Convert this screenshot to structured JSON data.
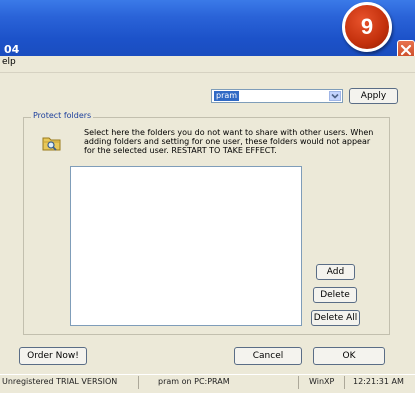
{
  "window": {
    "title": "04",
    "menu_text": "elp"
  },
  "step_badge": "9",
  "user_select": {
    "value": "pram"
  },
  "toolbar": {
    "apply_label": "Apply"
  },
  "protect_folders": {
    "group_label": "Protect folders",
    "description": "Select here the folders you do not want to share with other users. When adding folders and setting for one user, these folders would not appear for the selected user. RESTART TO TAKE EFFECT.",
    "add_label": "Add",
    "delete_label": "Delete",
    "delete_all_label": "Delete All"
  },
  "footer": {
    "order_label": "Order Now!",
    "cancel_label": "Cancel",
    "ok_label": "OK"
  },
  "statusbar": {
    "registration": "Unregistered TRIAL VERSION",
    "user_machine": "pram on PC:PRAM",
    "os": "WinXP",
    "time": "12:21:31 AM"
  },
  "colors": {
    "title_bar": "#2a63d8",
    "badge": "#c3300c",
    "selection": "#316ac5"
  }
}
